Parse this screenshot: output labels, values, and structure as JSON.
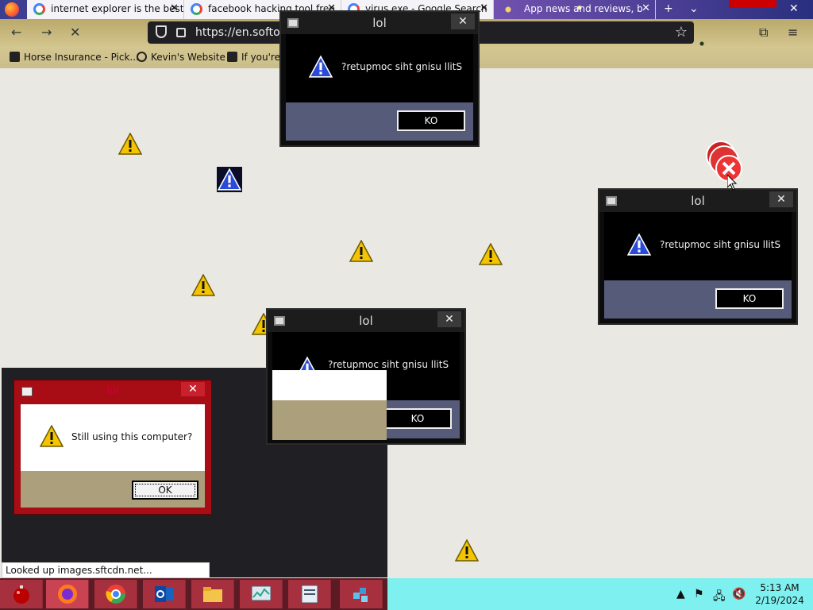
{
  "browser": {
    "tabs": [
      {
        "label": "internet explorer is the best",
        "close": "✕"
      },
      {
        "label": "facebook hacking tool free",
        "close": "✕"
      },
      {
        "label": "virus.exe - Google Search",
        "close": "✕"
      },
      {
        "label": "App news and reviews, b",
        "close": "✕"
      }
    ],
    "new_tab": "+",
    "tab_list": "⌄",
    "url": "https://en.softoni",
    "bookmarks": [
      {
        "label": "Horse Insurance - Pick..."
      },
      {
        "label": "Kevin's Website"
      },
      {
        "label": "If you're"
      }
    ]
  },
  "dialogs": [
    {
      "title": "lol",
      "message": "?retupmoc siht gnisu llitS",
      "button": "KO",
      "close": "✕"
    },
    {
      "title": "lol",
      "message": "?retupmoc siht gnisu llitS",
      "button": "KO",
      "close": "✕"
    },
    {
      "title": "lol",
      "message": "?retupmoc siht gnisu llitS",
      "button": "KO",
      "close": "✕"
    }
  ],
  "red_dialog": {
    "title": "lol",
    "message": "Still using this computer?",
    "button": "OK",
    "close": "✕"
  },
  "status_text": "Looked up images.sftcdn.net...",
  "taskbar": {
    "apps": [
      "christmas-ornament",
      "firefox",
      "chrome",
      "outlook",
      "file-explorer",
      "task-manager",
      "notepad",
      "registry-editor"
    ],
    "clock_time": "5:13 AM",
    "clock_date": "2/19/2024"
  },
  "colors": {
    "dialog_footer": "#575b7a",
    "red_dialog": "#a80d16",
    "taskbar": "#7ef0ef"
  }
}
